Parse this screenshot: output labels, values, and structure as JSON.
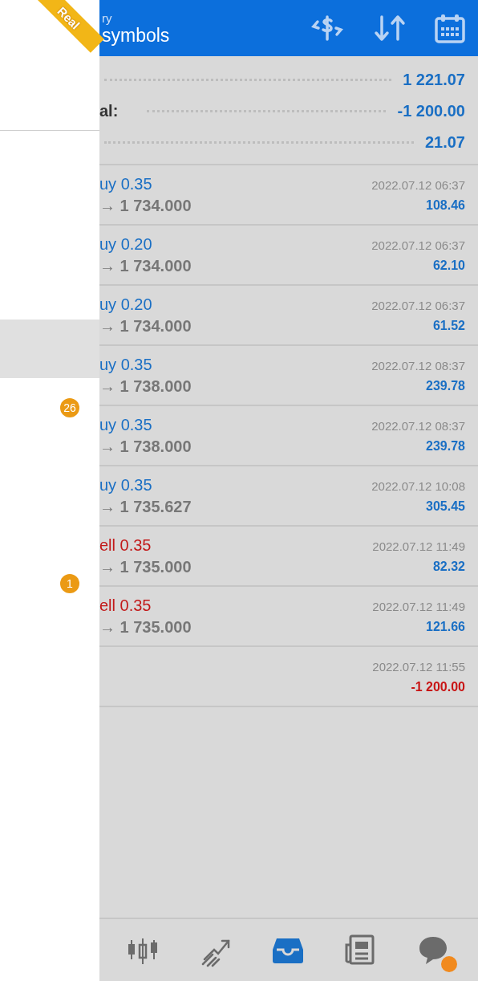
{
  "drawer": {
    "ribbon": "Real",
    "items": [
      {
        "selected": false
      },
      {
        "selected": false
      },
      {
        "selected": false
      },
      {
        "selected": true
      },
      {
        "badge": "26",
        "selected": false
      },
      {
        "selected": false
      },
      {
        "selected": false
      },
      {
        "badge": "1",
        "selected": false
      }
    ]
  },
  "header": {
    "subtitle": "ry",
    "title": "symbols",
    "actions": [
      {
        "kind": "exchange"
      },
      {
        "kind": "sort"
      },
      {
        "kind": "calendar"
      }
    ]
  },
  "summary": [
    {
      "value": "1 221.07"
    },
    {
      "label": "al:",
      "value": "-1 200.00"
    },
    {
      "value": "21.07"
    }
  ],
  "deals": [
    {
      "kind": "buy",
      "title": "uy 0.35",
      "price": "→ 1 734.000",
      "time": "2022.07.12 06:37",
      "profit": "108.46",
      "loss": false
    },
    {
      "kind": "buy",
      "title": "uy 0.20",
      "price": "→ 1 734.000",
      "time": "2022.07.12 06:37",
      "profit": "62.10",
      "loss": false
    },
    {
      "kind": "buy",
      "title": "uy 0.20",
      "price": "→ 1 734.000",
      "time": "2022.07.12 06:37",
      "profit": "61.52",
      "loss": false
    },
    {
      "kind": "buy",
      "title": "uy 0.35",
      "price": "→ 1 738.000",
      "time": "2022.07.12 08:37",
      "profit": "239.78",
      "loss": false
    },
    {
      "kind": "buy",
      "title": "uy 0.35",
      "price": "→ 1 738.000",
      "time": "2022.07.12 08:37",
      "profit": "239.78",
      "loss": false
    },
    {
      "kind": "buy",
      "title": "uy 0.35",
      "price": "→ 1 735.627",
      "time": "2022.07.12 10:08",
      "profit": "305.45",
      "loss": false
    },
    {
      "kind": "sell",
      "title": "ell 0.35",
      "price": "→ 1 735.000",
      "time": "2022.07.12 11:49",
      "profit": "82.32",
      "loss": false
    },
    {
      "kind": "sell",
      "title": "ell 0.35",
      "price": "→ 1 735.000",
      "time": "2022.07.12 11:49",
      "profit": "121.66",
      "loss": false
    },
    {
      "kind": "balance",
      "time": "2022.07.12 11:55",
      "profit": "-1 200.00",
      "loss": true
    }
  ],
  "nav": [
    {
      "kind": "quotes",
      "selected": false,
      "dot": false
    },
    {
      "kind": "trade",
      "selected": false,
      "dot": false
    },
    {
      "kind": "history",
      "selected": true,
      "dot": false
    },
    {
      "kind": "news",
      "selected": false,
      "dot": false
    },
    {
      "kind": "chat",
      "selected": false,
      "dot": true
    }
  ]
}
